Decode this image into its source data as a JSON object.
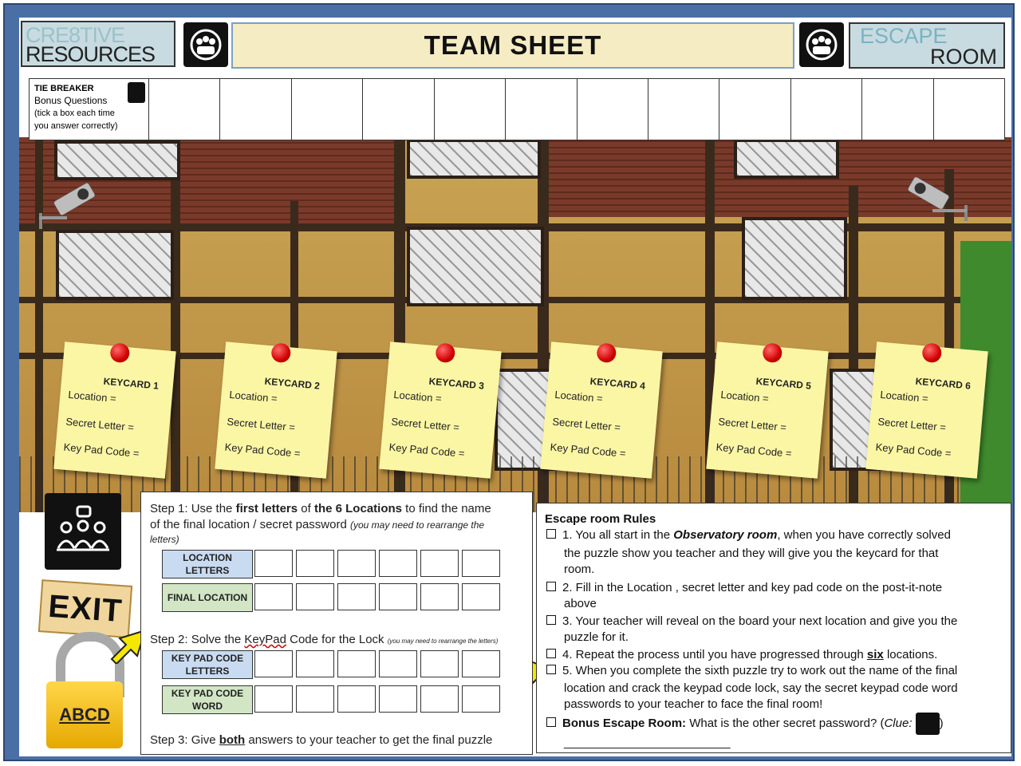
{
  "header": {
    "logo_left_line1": "CRE8TIVE",
    "logo_left_line2": "RESOURCES",
    "title": "TEAM SHEET",
    "logo_right_line1": "ESCAPE",
    "logo_right_line2": "ROOM"
  },
  "tie_breaker": {
    "heading": "TIE BREAKER",
    "line1": "Bonus Questions",
    "line2": "(tick  a box each time",
    "line3": "you answer correctly)",
    "box_count": 12
  },
  "keycards": [
    {
      "title": "KEYCARD 1",
      "location": "Location =",
      "secret": "Secret Letter =",
      "keypad": "Key Pad Code ="
    },
    {
      "title": "KEYCARD 2",
      "location": "Location =",
      "secret": "Secret Letter =",
      "keypad": "Key Pad Code ="
    },
    {
      "title": "KEYCARD 3",
      "location": "Location =",
      "secret": "Secret Letter =",
      "keypad": "Key Pad Code ="
    },
    {
      "title": "KEYCARD 4",
      "location": "Location =",
      "secret": "Secret Letter =",
      "keypad": "Key Pad Code ="
    },
    {
      "title": "KEYCARD 5",
      "location": "Location =",
      "secret": "Secret Letter =",
      "keypad": "Key Pad Code ="
    },
    {
      "title": "KEYCARD 6",
      "location": "Location =",
      "secret": "Secret Letter =",
      "keypad": "Key Pad Code ="
    }
  ],
  "side": {
    "exit_label": "EXIT",
    "lock_label": "ABCD"
  },
  "steps": {
    "step1_a": "Step 1: Use the ",
    "step1_b": "first letters",
    "step1_c": " of ",
    "step1_d": "the 6 Locations",
    "step1_e": " to find the  name",
    "step1_line2": "of the final location / secret password ",
    "step1_note": "(you may need to rearrange the",
    "step1_note2": "letters)",
    "row_location_letters": "LOCATION LETTERS",
    "row_final_location": "FINAL LOCATION",
    "step2_a": "Step 2: Solve the ",
    "step2_b": "KeyPad",
    "step2_c": " Code for the Lock ",
    "step2_note": "(you may need to rearrange the letters)",
    "row_keypad_letters": "KEY PAD CODE LETTERS",
    "row_keypad_word": "KEY PAD CODE WORD",
    "step3_a": "Step 3: Give ",
    "step3_b": "both",
    "step3_c": " answers to your teacher to get the final puzzle"
  },
  "rules": {
    "heading": "Escape room Rules",
    "r1_a": "1. You all start in the ",
    "r1_b": "Observatory room",
    "r1_c": ", when you have correctly solved",
    "r1_line2": "the puzzle show you teacher and they will give you the keycard for that",
    "r1_line3": "room.",
    "r2_line1": "2. Fill in the Location , secret letter and key pad code on the post-it-note",
    "r2_line2": "above",
    "r3_line1": "3. Your teacher will reveal on the board your next location and give you the",
    "r3_line2": "puzzle for it.",
    "r4_a": "4. Repeat the process until you have progressed through ",
    "r4_b": "six",
    "r4_c": " locations.",
    "r5_line1": "5. When you complete the sixth puzzle try to work out the name of the final",
    "r5_line2": "location and crack the keypad code lock, say the secret keypad code word",
    "r5_line3": "passwords to your teacher to face the final room!",
    "bonus_a": "Bonus Escape Room:",
    "bonus_b": " What is the other secret password? (",
    "bonus_c": "Clue:",
    "bonus_d": ")",
    "bonus_line": "_________________________"
  }
}
